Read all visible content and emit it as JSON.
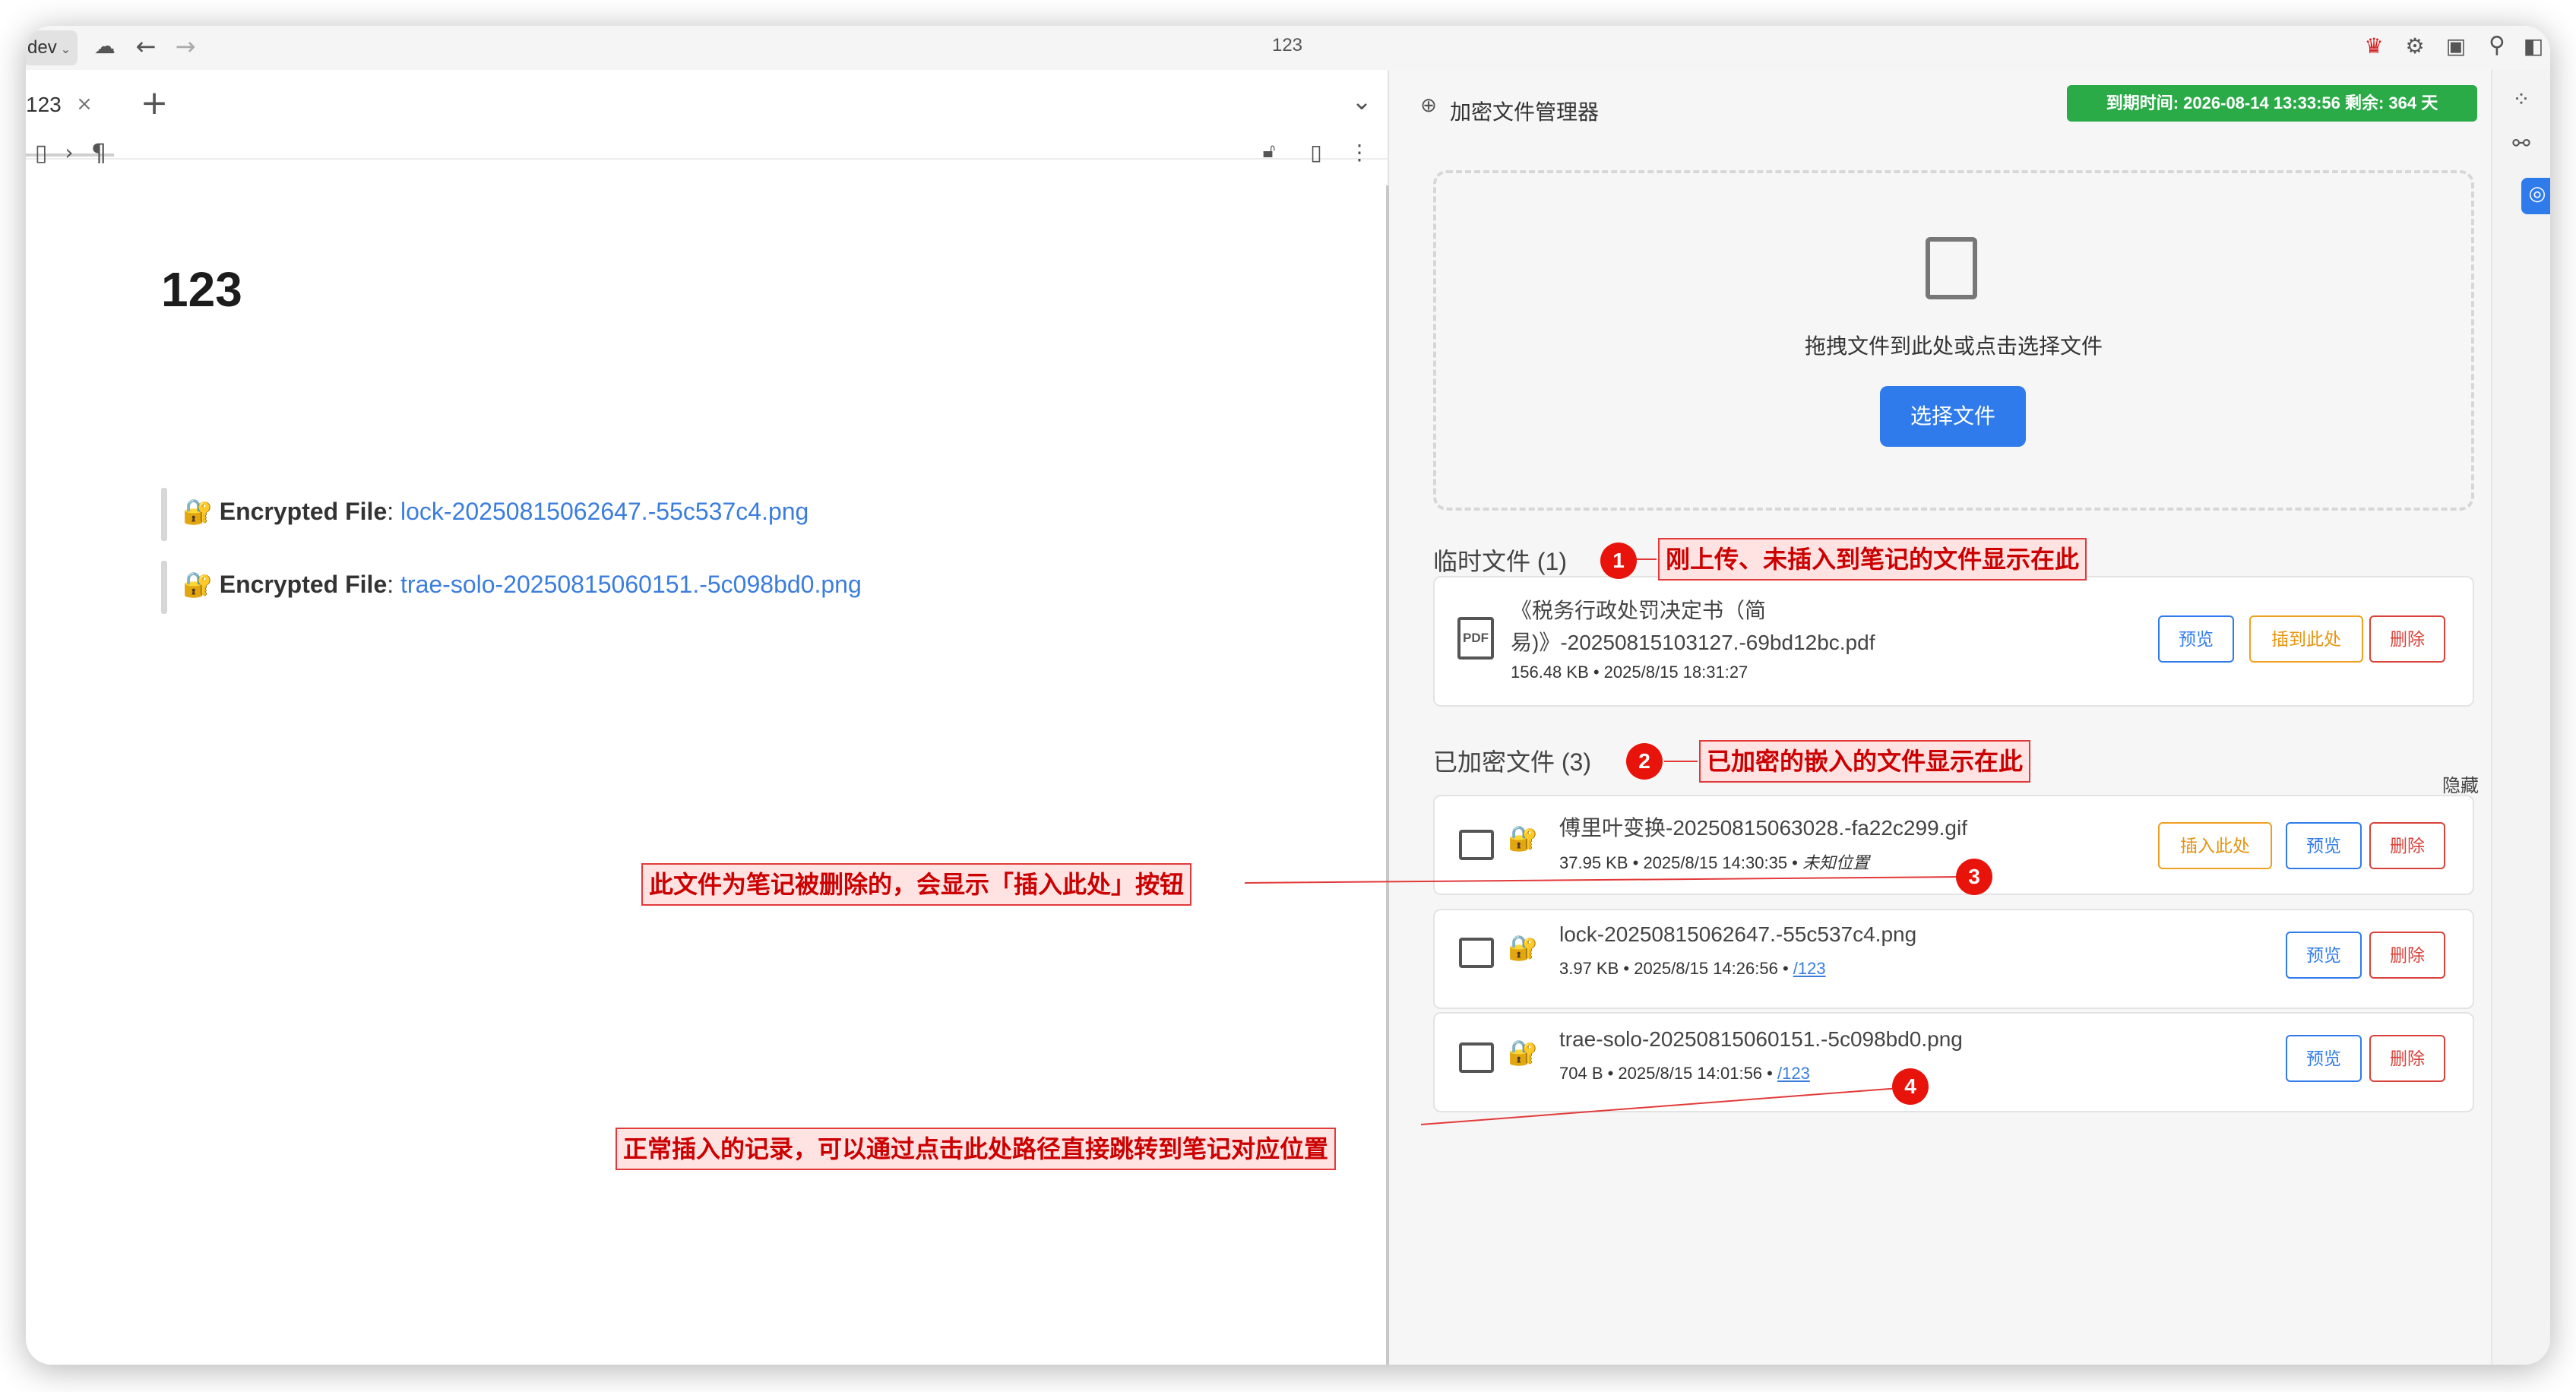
{
  "app": {
    "workspace_label": "dev",
    "window_title": "123",
    "tab_title": "123",
    "doc_title": "123"
  },
  "editor": {
    "embeds": [
      {
        "label": "Encrypted File",
        "separator": ":",
        "link": "lock-20250815062647.-55c537c4.png"
      },
      {
        "label": "Encrypted File",
        "separator": ":",
        "link": "trae-solo-20250815060151.-5c098bd0.png"
      }
    ]
  },
  "panel": {
    "title": "加密文件管理器",
    "expire": "到期时间: 2026-08-14 13:33:56 剩余: 364 天",
    "drop_text": "拖拽文件到此处或点击选择文件",
    "choose_button": "选择文件",
    "temp_section": "临时文件 (1)",
    "temp_files": [
      {
        "name_line1": "《税务行政处罚决定书（简",
        "name_line2": "易)》-20250815103127.-69bd12bc.pdf",
        "meta": "156.48 KB • 2025/8/15 18:31:27",
        "icon": "pdf-icon",
        "btn_preview": "预览",
        "btn_insert": "插到此处",
        "btn_delete": "删除"
      }
    ],
    "enc_section": "已加密文件 (3)",
    "hide_label": "隐藏",
    "enc_files": [
      {
        "name": "傅里叶变换-20250815063028.-fa22c299.gif",
        "meta": "37.95 KB • 2025/8/15 14:30:35 •",
        "location": "未知位置",
        "btn_insert": "插入此处",
        "btn_preview": "预览",
        "btn_delete": "删除"
      },
      {
        "name": "lock-20250815062647.-55c537c4.png",
        "meta": "3.97 KB • 2025/8/15 14:26:56 •",
        "location": "/123",
        "btn_preview": "预览",
        "btn_delete": "删除"
      },
      {
        "name": "trae-solo-20250815060151.-5c098bd0.png",
        "meta": "704 B • 2025/8/15 14:01:56 •",
        "location": "/123",
        "btn_preview": "预览",
        "btn_delete": "删除"
      }
    ]
  },
  "annotations": {
    "a1": "刚上传、未插入到笔记的文件显示在此",
    "a2": "已加密的嵌入的文件显示在此",
    "a3": "此文件为笔记被删除的，会显示「插入此处」按钮",
    "a4": "正常插入的记录，可以通过点击此处路径直接跳转到笔记对应位置",
    "n1": "1",
    "n2": "2",
    "n3": "3",
    "n4": "4"
  },
  "colors": {
    "accent": "#2f7bec",
    "success": "#2bab48",
    "danger": "#d9423a",
    "warning": "#f0a020",
    "annotation": "#e8140c"
  }
}
